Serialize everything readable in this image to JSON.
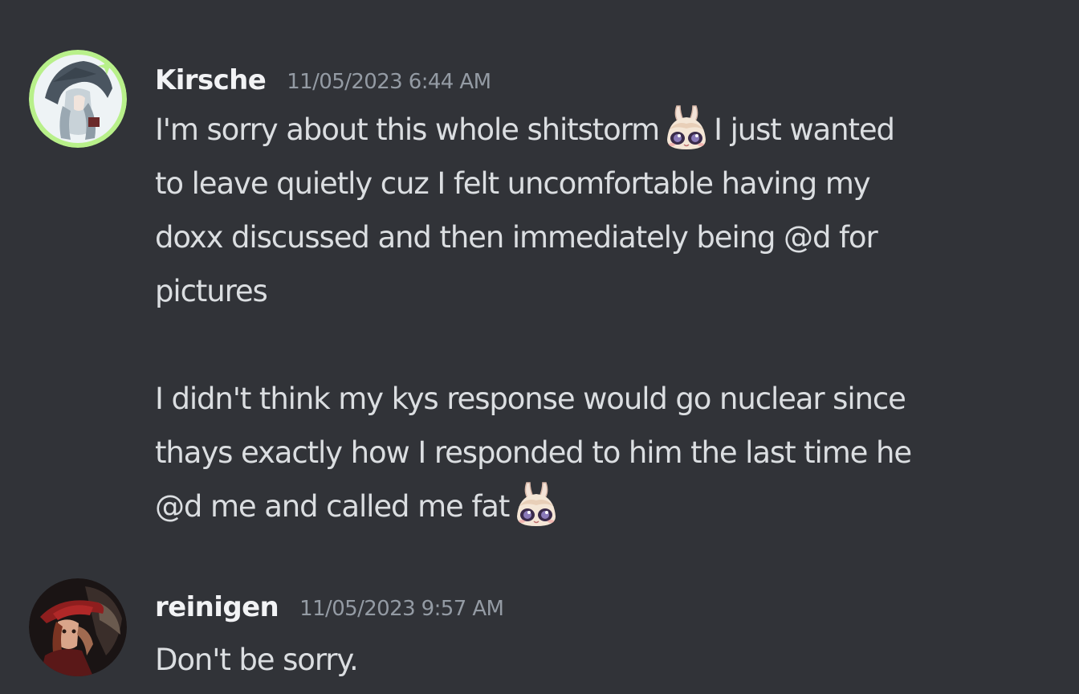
{
  "messages": [
    {
      "username": "Kirsche",
      "timestamp": "11/05/2023 6:44 AM",
      "avatar_icon": "anime-character-avatar-icon",
      "avatar_ring_color": "#b8f08a",
      "username_color": "#f2f3f5",
      "lines": {
        "l1_a": "I'm sorry about this whole shitstorm",
        "l1_b": "I just wanted",
        "l2": "to leave quietly cuz I felt uncomfortable having my",
        "l3": "doxx discussed and then immediately being @d for",
        "l4": "pictures",
        "l6": "I didn't think my kys response would go nuclear since",
        "l7": "thays exactly how I responded to him the last time he",
        "l8": "@d me and called me fat"
      },
      "emoji_icon": "bunny-girl-crying-emoji-icon"
    },
    {
      "username": "reinigen",
      "timestamp": "11/05/2023 9:57 AM",
      "avatar_icon": "red-mage-avatar-icon",
      "username_color": "#f2f3f5",
      "text": "Don't be sorry."
    }
  ],
  "colors": {
    "background": "#313338",
    "text": "#dbdee1",
    "timestamp": "#949ba4"
  }
}
